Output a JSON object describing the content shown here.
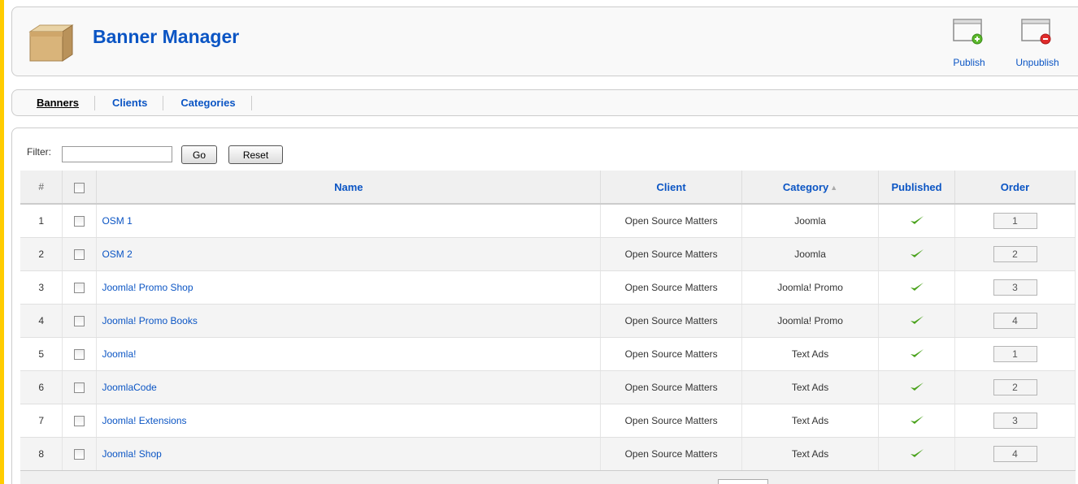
{
  "header": {
    "title": "Banner Manager",
    "toolbar": [
      {
        "label": "Publish",
        "icon": "publish-icon"
      },
      {
        "label": "Unpublish",
        "icon": "unpublish-icon"
      }
    ]
  },
  "submenu": {
    "items": [
      {
        "label": "Banners",
        "active": true
      },
      {
        "label": "Clients",
        "active": false
      },
      {
        "label": "Categories",
        "active": false
      }
    ]
  },
  "filter": {
    "label": "Filter:",
    "value": "",
    "go_label": "Go",
    "reset_label": "Reset"
  },
  "table": {
    "columns": {
      "num": "#",
      "name": "Name",
      "client": "Client",
      "category": "Category",
      "published": "Published",
      "order": "Order"
    },
    "rows": [
      {
        "num": "1",
        "name": "OSM 1",
        "client": "Open Source Matters",
        "category": "Joomla",
        "published": true,
        "order": "1"
      },
      {
        "num": "2",
        "name": "OSM 2",
        "client": "Open Source Matters",
        "category": "Joomla",
        "published": true,
        "order": "2"
      },
      {
        "num": "3",
        "name": "Joomla! Promo Shop",
        "client": "Open Source Matters",
        "category": "Joomla! Promo",
        "published": true,
        "order": "3"
      },
      {
        "num": "4",
        "name": "Joomla! Promo Books",
        "client": "Open Source Matters",
        "category": "Joomla! Promo",
        "published": true,
        "order": "4"
      },
      {
        "num": "5",
        "name": "Joomla!",
        "client": "Open Source Matters",
        "category": "Text Ads",
        "published": true,
        "order": "1"
      },
      {
        "num": "6",
        "name": "JoomlaCode",
        "client": "Open Source Matters",
        "category": "Text Ads",
        "published": true,
        "order": "2"
      },
      {
        "num": "7",
        "name": "Joomla! Extensions",
        "client": "Open Source Matters",
        "category": "Text Ads",
        "published": true,
        "order": "3"
      },
      {
        "num": "8",
        "name": "Joomla! Shop",
        "client": "Open Source Matters",
        "category": "Text Ads",
        "published": true,
        "order": "4"
      }
    ]
  },
  "colors": {
    "link": "#0b55c4",
    "frame": "#ffcc00",
    "check": "#4aa21c"
  }
}
